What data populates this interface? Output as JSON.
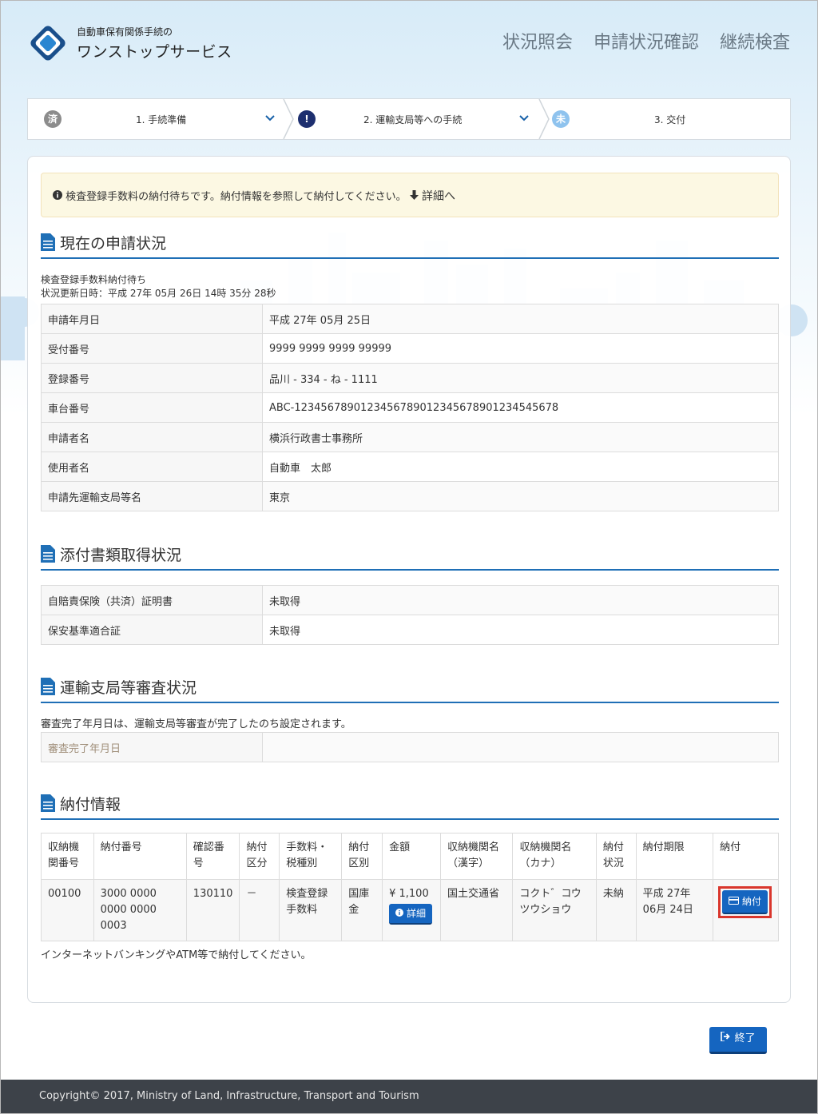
{
  "header": {
    "logo_small": "自動車保有関係手続の",
    "logo_big": "ワンストップサービス",
    "nav": [
      "状況照会",
      "申請状況確認",
      "継続検査"
    ]
  },
  "steps": [
    {
      "badge": "済",
      "label": "1. 手続準備"
    },
    {
      "badge": "!",
      "label": "2. 運輸支局等への手続"
    },
    {
      "badge": "未",
      "label": "3. 交付"
    }
  ],
  "alert": {
    "message": "検査登録手数料の納付待ちです。納付情報を参照して納付してください。",
    "link": "詳細へ"
  },
  "sections": {
    "status": "現在の申請状況",
    "docs": "添付書類取得状況",
    "review": "運輸支局等審査状況",
    "payment": "納付情報"
  },
  "status": {
    "state": "検査登録手数料納付待ち",
    "updated": "状況更新日時：平成 27年 05月 26日 14時 35分 28秒",
    "rows": [
      {
        "k": "申請年月日",
        "v": "平成 27年 05月 25日"
      },
      {
        "k": "受付番号",
        "v": "9999 9999 9999 99999"
      },
      {
        "k": "登録番号",
        "v": "品川 - 334 - ね - 1111"
      },
      {
        "k": "車台番号",
        "v": "ABC-1234567890123456789012345678901234545678"
      },
      {
        "k": "申請者名",
        "v": "横浜行政書士事務所"
      },
      {
        "k": "使用者名",
        "v": "自動車　太郎"
      },
      {
        "k": "申請先運輸支局等名",
        "v": "東京"
      }
    ]
  },
  "docs": {
    "rows": [
      {
        "k": "自賠責保険（共済）証明書",
        "v": "未取得"
      },
      {
        "k": "保安基準適合証",
        "v": "未取得"
      }
    ]
  },
  "review": {
    "note": "審査完了年月日は、運輸支局等審査が完了したのち設定されます。",
    "row": {
      "k": "審査完了年月日",
      "v": ""
    }
  },
  "payment": {
    "headers": [
      "収納機関番号",
      "納付番号",
      "確認番号",
      "納付区分",
      "手数料・税種別",
      "納付区別",
      "金額",
      "収納機関名（漢字）",
      "収納機関名（カナ）",
      "納付状況",
      "納付期限",
      "納付"
    ],
    "row": {
      "agency_no": "00100",
      "pay_no": "3000 0000 0000 0000 0003",
      "confirm_no": "130110",
      "pay_class": "－",
      "fee_type": "検査登録手数料",
      "pay_kind": "国庫金",
      "amount": "¥ 1,100",
      "detail_btn": "詳細",
      "agency_kanji": "国土交通省",
      "agency_kana": "コクト゛コウツウショウ",
      "pay_status": "未納",
      "deadline": "平成 27年 06月 24日",
      "pay_btn": "納付"
    },
    "note": "インターネットバンキングやATM等で納付してください。"
  },
  "end_button": "終了",
  "footer": "Copyright© 2017, Ministry of Land, Infrastructure, Transport and Tourism"
}
